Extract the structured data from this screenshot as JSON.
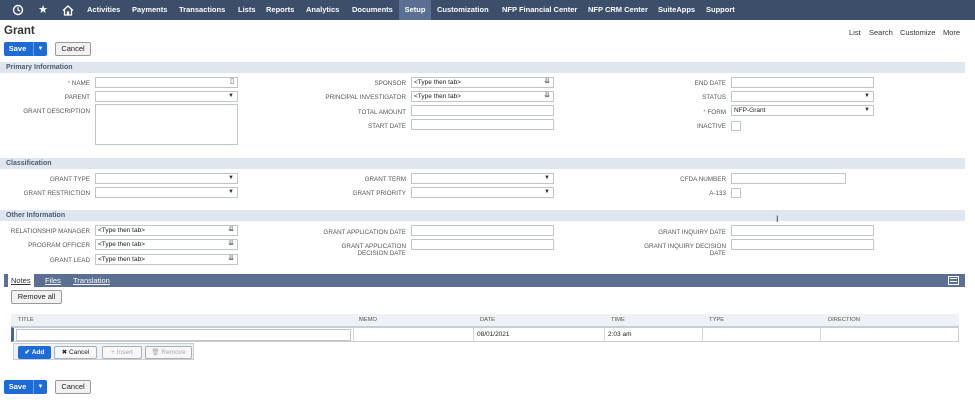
{
  "nav": {
    "items": [
      "Activities",
      "Payments",
      "Transactions",
      "Lists",
      "Reports",
      "Analytics",
      "Documents",
      "Setup",
      "Customization",
      "NFP Financial Center",
      "NFP CRM Center",
      "SuiteApps",
      "Support"
    ],
    "active": "Setup"
  },
  "page": {
    "title": "Grant"
  },
  "top_links": {
    "list": "List",
    "search": "Search",
    "customize": "Customize",
    "more": "More"
  },
  "buttons": {
    "save": "Save",
    "cancel": "Cancel"
  },
  "sections": {
    "primary": "Primary Information",
    "classification": "Classification",
    "other": "Other Information"
  },
  "primary": {
    "name_label": "NAME",
    "parent_label": "PARENT",
    "description_label": "GRANT DESCRIPTION",
    "sponsor_label": "SPONSOR",
    "sponsor_value": "<Type then tab>",
    "pi_label": "PRINCIPAL INVESTIGATOR",
    "pi_value": "<Type then tab>",
    "total_amount_label": "TOTAL AMOUNT",
    "start_date_label": "START DATE",
    "end_date_label": "END DATE",
    "status_label": "STATUS",
    "form_label": "FORM",
    "form_value": "NFP-Grant",
    "inactive_label": "INACTIVE"
  },
  "classification": {
    "grant_type_label": "GRANT TYPE",
    "grant_restriction_label": "GRANT RESTRICTION",
    "grant_term_label": "GRANT TERM",
    "grant_priority_label": "GRANT PRIORITY",
    "cfda_label": "CFDA NUMBER",
    "a133_label": "A-133"
  },
  "other": {
    "rel_manager_label": "RELATIONSHIP MANAGER",
    "rel_manager_value": "<Type then tab>",
    "program_officer_label": "PROGRAM OFFICER",
    "program_officer_value": "<Type then tab>",
    "grant_lead_label": "GRANT LEAD",
    "grant_lead_value": "<Type then tab>",
    "app_date_label": "GRANT APPLICATION DATE",
    "app_decision_label_1": "GRANT APPLICATION",
    "app_decision_label_2": "DECISION DATE",
    "inquiry_date_label": "GRANT INQUIRY DATE",
    "inquiry_decision_label_1": "GRANT INQUIRY DECISION",
    "inquiry_decision_label_2": "DATE"
  },
  "subtabs": {
    "notes": "Notes",
    "files": "Files",
    "translation": "Translation"
  },
  "notes": {
    "remove_all": "Remove all",
    "columns": [
      "TITLE",
      "MEMO",
      "DATE",
      "TIME",
      "TYPE",
      "DIRECTION"
    ],
    "row": {
      "date": "08/01/2021",
      "time": "2:03 am"
    },
    "row_buttons": {
      "add": "Add",
      "cancel": "Cancel",
      "insert": "Insert",
      "remove": "Remove"
    }
  },
  "colors": {
    "nav_bg": "#3c4e6a",
    "accent": "#1e6bd6",
    "section_bg": "#dfe6f0",
    "required": "#e7792b"
  }
}
